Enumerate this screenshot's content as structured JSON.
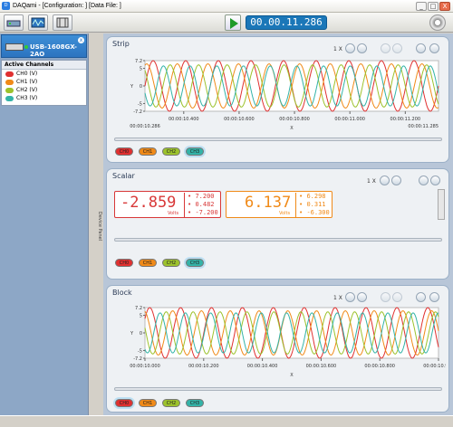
{
  "window": {
    "title": "DAQami - [Configuration: ] [Data File: ]",
    "minimize": "_",
    "maximize": "□",
    "close": "X"
  },
  "toolbar": {
    "timer": "00.00.11.286"
  },
  "device": {
    "name": "USB-1608GX-2AO",
    "close": "x"
  },
  "channels": {
    "header": "Active Channels",
    "items": [
      {
        "label": "CH0 (V)",
        "color": "#e03030"
      },
      {
        "label": "CH1 (V)",
        "color": "#f08a18"
      },
      {
        "label": "CH2 (V)",
        "color": "#9cc22c"
      },
      {
        "label": "CH3 (V)",
        "color": "#33b3a8"
      }
    ]
  },
  "device_panel_label": "Device Panel",
  "chips": [
    "CH0",
    "CH1",
    "CH2",
    "CH3"
  ],
  "strip": {
    "title": "Strip",
    "zoom": "1 X",
    "ylabel": "Y",
    "xlabel": "X",
    "yticks": [
      "7.2",
      "5",
      "0",
      "-5",
      "-7.2"
    ],
    "xticks": [
      "00:00:10.400",
      "00:00:10.600",
      "00:00:10.800",
      "00:00:11.000",
      "00:00:11.200"
    ],
    "xstart": "00:00:10.286",
    "xend": "00:00:11.285"
  },
  "scalar": {
    "title": "Scalar",
    "zoom": "1 X",
    "ch0": {
      "value": "-2.859",
      "unit": "Volts",
      "max": "7.200",
      "avg": "0.482",
      "min": "-7.200"
    },
    "ch1": {
      "value": "6.137",
      "unit": "Volts",
      "max": "6.298",
      "avg": "0.311",
      "min": "-6.300"
    }
  },
  "block": {
    "title": "Block",
    "zoom": "1 X",
    "ylabel": "Y",
    "xlabel": "X",
    "yticks": [
      "7.2",
      "5",
      "0",
      "-5",
      "-7.2"
    ],
    "xticks": [
      "00:00:10.000",
      "00:00:10.200",
      "00:00:10.400",
      "00:00:10.600",
      "00:00:10.800",
      "00:00:10.999"
    ]
  },
  "chart_data": [
    {
      "type": "line",
      "title": "Strip",
      "xlabel": "X",
      "ylabel": "Y",
      "ylim": [
        -7.2,
        7.2
      ],
      "xlim": [
        "00:00:10.286",
        "00:00:11.285"
      ],
      "series": [
        {
          "name": "CH0",
          "color": "#e03030",
          "amplitude": 7.2,
          "cycles": 9,
          "phase": 0.0
        },
        {
          "name": "CH1",
          "color": "#f08a18",
          "amplitude": 6.3,
          "cycles": 9.6,
          "phase": 1.2
        },
        {
          "name": "CH2",
          "color": "#9cc22c",
          "amplitude": 6.0,
          "cycles": 10.3,
          "phase": 2.3
        },
        {
          "name": "CH3",
          "color": "#33b3a8",
          "amplitude": 5.7,
          "cycles": 11.0,
          "phase": 3.5
        }
      ]
    },
    {
      "type": "line",
      "title": "Block",
      "xlabel": "X",
      "ylabel": "Y",
      "ylim": [
        -7.2,
        7.2
      ],
      "xlim": [
        "00:00:10.000",
        "00:00:10.999"
      ],
      "series": [
        {
          "name": "CH0",
          "color": "#e03030",
          "amplitude": 7.2,
          "cycles": 9.5,
          "phase": 0.6
        },
        {
          "name": "CH1",
          "color": "#f08a18",
          "amplitude": 6.3,
          "cycles": 10.2,
          "phase": 1.8
        },
        {
          "name": "CH2",
          "color": "#9cc22c",
          "amplitude": 6.0,
          "cycles": 10.9,
          "phase": 2.9
        },
        {
          "name": "CH3",
          "color": "#33b3a8",
          "amplitude": 5.7,
          "cycles": 11.6,
          "phase": 4.1
        }
      ]
    }
  ]
}
